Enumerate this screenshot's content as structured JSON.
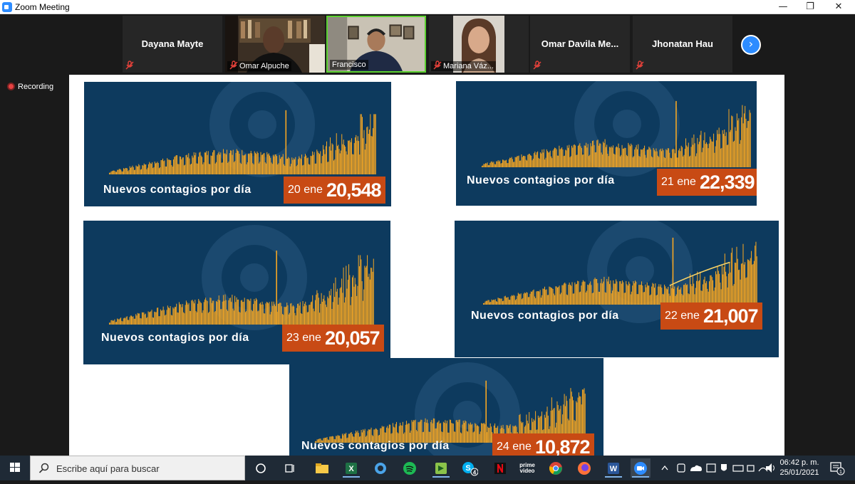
{
  "window": {
    "title": "Zoom Meeting",
    "controls": {
      "minimize": "—",
      "restore": "❐",
      "close": "✕"
    }
  },
  "participants": [
    {
      "name": "Dayana Mayte",
      "video": false
    },
    {
      "name": "Omar Alpuche",
      "video": true
    },
    {
      "name": "Francisco",
      "video": true,
      "active_speaker": true
    },
    {
      "name": "Mariana Váz...",
      "video": true
    },
    {
      "name": "Omar  Davila  Me...",
      "video": false
    },
    {
      "name": "Jhonatan Hau",
      "video": false
    }
  ],
  "recording": {
    "label": "Recording"
  },
  "shared_content": {
    "caption": "Nuevos contagios por día",
    "panels": [
      {
        "date": "20 ene",
        "value": "20,548"
      },
      {
        "date": "21 ene",
        "value": "22,339"
      },
      {
        "date": "23 ene",
        "value": "20,057"
      },
      {
        "date": "22 ene",
        "value": "21,007"
      },
      {
        "date": "24 ene",
        "value": "10,872"
      }
    ]
  },
  "colors": {
    "panel_bg": "#0d3a5e",
    "bars": "#f5a623",
    "value_box": "#c84a14",
    "accent": "#2d8cff",
    "recording": "#e64242"
  },
  "taskbar": {
    "search_placeholder": "Escribe aquí para buscar",
    "apps": [
      "task-view-icon",
      "file-explorer-icon",
      "excel-icon",
      "app-icon",
      "spotify-icon",
      "app-icon",
      "skype-icon",
      "netflix-icon",
      "prime-video-icon",
      "chrome-icon",
      "firefox-icon",
      "word-icon",
      "zoom-icon"
    ],
    "skype_badge": "4",
    "prime_label": "prime video",
    "clock_time": "06:42 p. m.",
    "clock_date": "25/01/2021",
    "notifications_badge": "1"
  }
}
